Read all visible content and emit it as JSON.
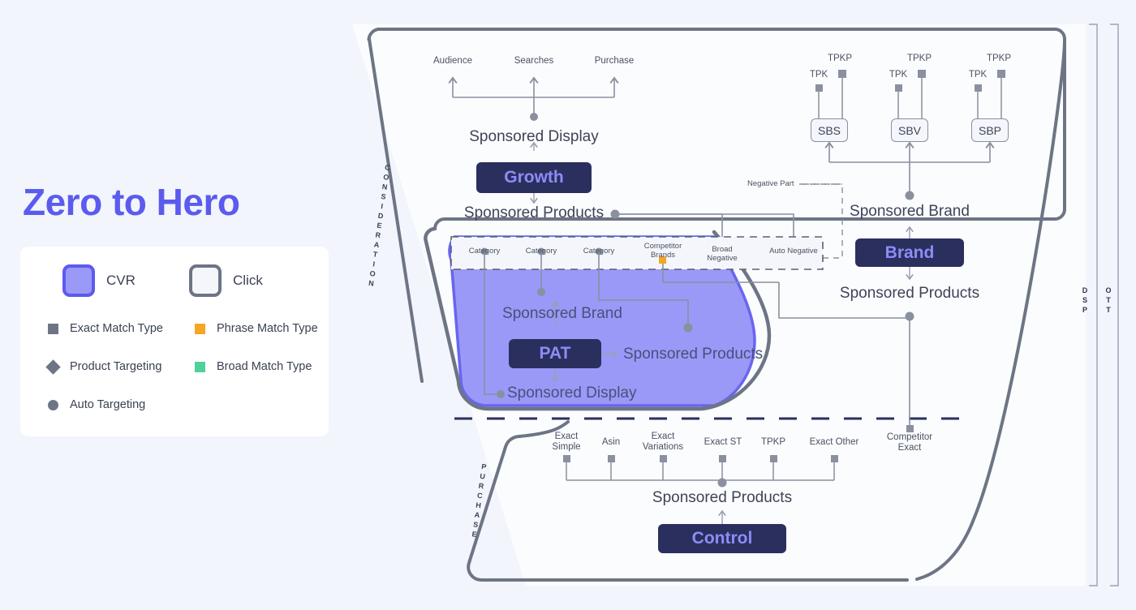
{
  "page": {
    "background": "#f2f5fc",
    "title": "Zero to Hero",
    "title_color": "#5b5bef"
  },
  "legend": {
    "primary": [
      {
        "label": "CVR",
        "icon": "rounded-square-filled-icon",
        "fill": "#9a99f7",
        "stroke": "#5b5bef"
      },
      {
        "label": "Click",
        "icon": "rounded-square-outline-icon",
        "fill": "#f4f6fb",
        "stroke": "#6d7585"
      }
    ],
    "items": [
      {
        "label": "Exact Match Type",
        "icon": "square-icon",
        "color": "#6d7585",
        "shape": "square"
      },
      {
        "label": "Phrase Match Type",
        "icon": "square-icon",
        "color": "#f5a623",
        "shape": "square"
      },
      {
        "label": "Product Targeting",
        "icon": "diamond-icon",
        "color": "#6d7585",
        "shape": "diamond"
      },
      {
        "label": "Broad Match Type",
        "icon": "square-icon",
        "color": "#4ed29a",
        "shape": "square"
      },
      {
        "label": "Auto Targeting",
        "icon": "circle-icon",
        "color": "#6d7585",
        "shape": "circle"
      }
    ]
  },
  "funnel": {
    "stage_labels": {
      "consideration": "CONSIDERATION",
      "purchase": "PURCHASE"
    },
    "right_rails": [
      {
        "label": "DSP"
      },
      {
        "label": "OTT"
      }
    ]
  },
  "consideration": {
    "top_targets": [
      "Audience",
      "Searches",
      "Purchase"
    ],
    "sponsored_display": "Sponsored Display",
    "growth_button": "Growth",
    "sponsored_products": "Sponsored Products"
  },
  "negative_part": {
    "title": "Negative Part",
    "nodes": [
      {
        "label": "Broad Negative",
        "marker": "square",
        "color": "#4ed29a"
      },
      {
        "label": "Auto Negative",
        "marker": "circle",
        "color": "#8a909f"
      }
    ]
  },
  "cvr_zone": {
    "strip_nodes": [
      {
        "label": "Category",
        "marker": "circle",
        "color": "#8a909f"
      },
      {
        "label": "Category",
        "marker": "circle",
        "color": "#8a909f"
      },
      {
        "label": "Category",
        "marker": "circle",
        "color": "#8a909f"
      },
      {
        "label": "Competitor Brands",
        "marker": "square",
        "color": "#f5a623"
      }
    ],
    "sponsored_brand": "Sponsored Brand",
    "pat_button": "PAT",
    "sponsored_products": "Sponsored Products",
    "sponsored_display": "Sponsored Display"
  },
  "brand_branch": {
    "boxes": [
      {
        "label": "SBS",
        "top_markers": [
          {
            "label": "TPK"
          },
          {
            "label": "TPKP"
          }
        ]
      },
      {
        "label": "SBV",
        "top_markers": [
          {
            "label": "TPK"
          },
          {
            "label": "TPKP"
          }
        ]
      },
      {
        "label": "SBP",
        "top_markers": [
          {
            "label": "TPK"
          },
          {
            "label": "TPKP"
          }
        ]
      }
    ],
    "sponsored_brand": "Sponsored Brand",
    "brand_button": "Brand",
    "sponsored_products": "Sponsored Products"
  },
  "purchase": {
    "nodes": [
      {
        "label": "Exact Simple",
        "lines": [
          "Exact",
          "Simple"
        ]
      },
      {
        "label": "Asin",
        "lines": [
          "Asin"
        ]
      },
      {
        "label": "Exact Variations",
        "lines": [
          "Exact",
          "Variations"
        ]
      },
      {
        "label": "Exact ST",
        "lines": [
          "Exact ST"
        ]
      },
      {
        "label": "TPKP",
        "lines": [
          "TPKP"
        ]
      },
      {
        "label": "Exact Other",
        "lines": [
          "Exact",
          "Other"
        ]
      }
    ],
    "competitor_exact": {
      "lines": [
        "Competitor",
        "Exact"
      ]
    },
    "sponsored_products": "Sponsored Products",
    "control_button": "Control"
  }
}
